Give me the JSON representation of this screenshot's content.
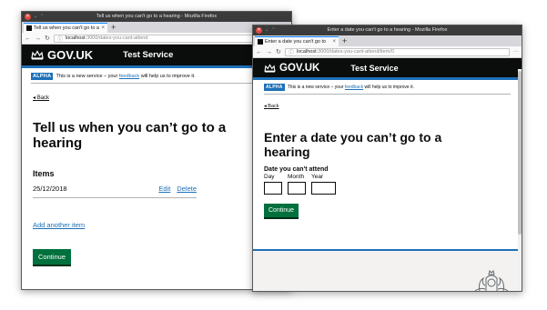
{
  "window1": {
    "title": "Tell us when you can't go to a hearing - Mozilla Firefox",
    "tab_title": "Tell us when you can't go to a",
    "url_host": "localhost",
    "url_path": ":3000/dates-you-cant-attend",
    "logo_text": "GOV.UK",
    "service_name": "Test Service",
    "phase_tag": "ALPHA",
    "phase_text_before": "This is a new service – your ",
    "phase_link": "feedback",
    "phase_text_after": " will help us to improve it.",
    "back_label": "Back",
    "heading": "Tell us when you can’t go to a hearing",
    "items_heading": "Items",
    "items": [
      {
        "date": "25/12/2018",
        "edit": "Edit",
        "delete": "Delete"
      }
    ],
    "add_another": "Add another item",
    "continue_label": "Continue"
  },
  "window2": {
    "title": "Enter a date you can't go to a hearing - Mozilla Firefox",
    "tab_title": "Enter a date you can't go to",
    "url_host": "localhost",
    "url_path": ":3000/dates-you-cant-attend/item/0",
    "logo_text": "GOV.UK",
    "service_name": "Test Service",
    "phase_tag": "ALPHA",
    "phase_text_before": "This is a new service – your ",
    "phase_link": "feedback",
    "phase_text_after": " will help us to improve it.",
    "back_label": "Back",
    "heading": "Enter a date you can’t go to a hearing",
    "date_legend": "Date you can't attend",
    "day_label": "Day",
    "month_label": "Month",
    "year_label": "Year",
    "day_value": "",
    "month_value": "",
    "year_value": "",
    "continue_label": "Continue"
  },
  "icons": {
    "close": "close-icon",
    "minimize": "minimize-icon",
    "maximize": "maximize-icon",
    "back_arrow": "arrow-left-icon",
    "forward_arrow": "arrow-right-icon",
    "reload": "reload-icon",
    "site_info": "info-icon",
    "menu": "ellipsis-icon",
    "new_tab": "plus-icon",
    "crown": "crown-icon",
    "royal_arms": "royal-arms-icon"
  },
  "colors": {
    "gov_header": "#0b0c0c",
    "gov_blue": "#1d70b8",
    "link": "#1d70b8",
    "button_green": "#00703c",
    "footer_bg": "#f3f2f1",
    "titlebar": "#3b3b3b"
  }
}
